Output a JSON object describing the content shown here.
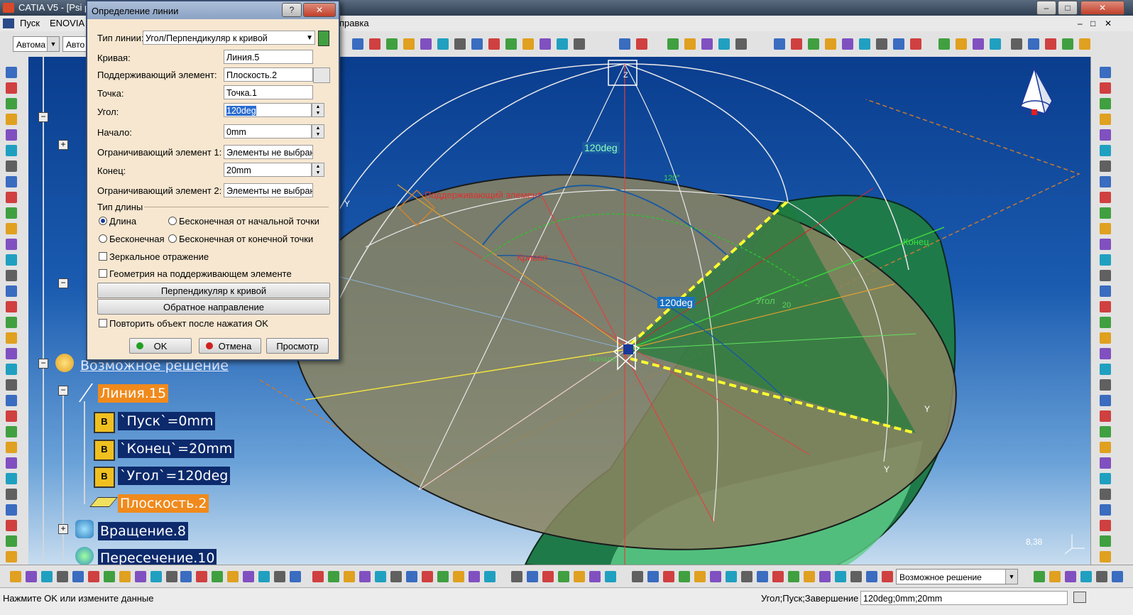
{
  "app": {
    "title": "CATIA V5 - [Psi pc",
    "menu": [
      "Пуск",
      "ENOVIA",
      "правка"
    ]
  },
  "toolbar": {
    "combo1": "Автома",
    "combo2": "Авто"
  },
  "dialog": {
    "title": "Определение линии",
    "help_btn": "?",
    "close_btn": "✕",
    "line_type_label": "Тип линии:",
    "line_type_value": "Угол/Перпендикуляр к кривой",
    "curve_label": "Кривая:",
    "curve_value": "Линия.5",
    "support_label": "Поддерживающий элемент:",
    "support_value": "Плоскость.2",
    "point_label": "Точка:",
    "point_value": "Точка.1",
    "angle_label": "Угол:",
    "angle_value": "120deg",
    "start_label": "Начало:",
    "start_value": "0mm",
    "limit1_label": "Ограничивающий элемент 1:",
    "limit1_value": "Элементы не выбраны",
    "end_label": "Конец:",
    "end_value": "20mm",
    "limit2_label": "Ограничивающий элемент 2:",
    "limit2_value": "Элементы не выбраны",
    "length_type_label": "Тип длины",
    "radio_length": "Длина",
    "radio_infinite_start": "Бесконечная от начальной точки",
    "radio_infinite": "Бесконечная",
    "radio_infinite_end": "Бесконечная от конечной точки",
    "mirror_label": "Зеркальное отражение",
    "geometry_on_support_label": "Геометрия на поддерживающем элементе",
    "perp_button": "Перпендикуляр к кривой",
    "reverse_button": "Обратное направление",
    "repeat_label": "Повторить объект после нажатия OK",
    "ok_button": "OK",
    "cancel_button": "Отмена",
    "preview_button": "Просмотр"
  },
  "tree": {
    "possible_solution": "Возможное решение",
    "line15": "Линия.15",
    "start": "`Пуск`=0mm",
    "end": "`Конец`=20mm",
    "angle": "`Угол`=120deg",
    "plane2": "Плоскость.2",
    "rotation8": "Вращение.8",
    "intersection10": "Пересечение.10"
  },
  "viewport": {
    "angle_top": "120deg",
    "angle_mid": "120deg",
    "angle_green": "120°",
    "support_element": "Поддерживающий элемент",
    "curve": "Кривая",
    "end_label": "Конец",
    "angle_label": "Угол",
    "angle_val": "20",
    "start_label": "Начало",
    "zoom": "8,38",
    "z_axis": "Z",
    "y_axis": "Y"
  },
  "bottom": {
    "combo_value": "Возможное решение"
  },
  "status": {
    "message": "Нажмите OK или измените данные",
    "params_label": "Угол;Пуск;Завершение",
    "params_value": "120deg;0mm;20mm"
  },
  "colors": {
    "accent_orange": "#f08a1c",
    "tree_bg": "#0c2a6c",
    "dialog_bg": "#f7e7d0"
  }
}
